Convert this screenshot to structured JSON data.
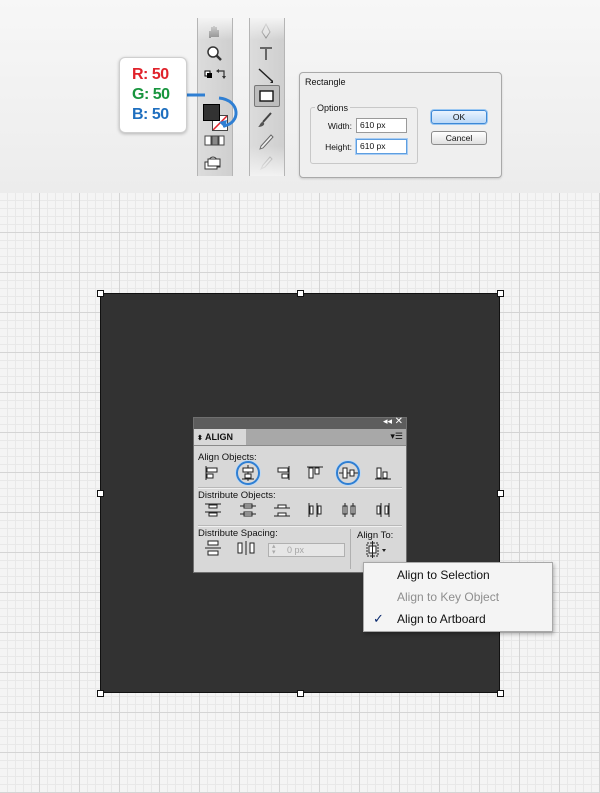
{
  "rgb_callout": {
    "r": "R: 50",
    "g": "G: 50",
    "b": "B: 50",
    "r_color": "#e0222b",
    "g_color": "#18953e",
    "b_color": "#1f6fbf"
  },
  "fill_color": "#323232",
  "tool_icons_left": [
    "hand-icon",
    "zoom-icon",
    "default-fill-stroke-icon",
    "swap-fill-stroke-icon",
    "fill-swatch",
    "stroke-swatch",
    "color-mode-icon",
    "draw-mode-icon",
    "screen-mode-icon"
  ],
  "tool_icons_right": [
    "pen-icon",
    "type-icon",
    "line-segment-icon",
    "rectangle-tool-icon",
    "paintbrush-icon",
    "pencil-icon",
    "blob-brush-icon"
  ],
  "rect_dialog": {
    "title": "Rectangle",
    "group_label": "Options",
    "width_label": "Width:",
    "width_value": "610 px",
    "height_label": "Height:",
    "height_value": "610 px",
    "ok_label": "OK",
    "cancel_label": "Cancel"
  },
  "align_panel": {
    "tab_label": "ALIGN",
    "align_objects_label": "Align Objects:",
    "distribute_objects_label": "Distribute Objects:",
    "distribute_spacing_label": "Distribute Spacing:",
    "align_to_label": "Align To:",
    "spacing_value": "0 px",
    "highlighted": [
      "horizontal-align-center",
      "vertical-align-center"
    ]
  },
  "align_to_menu": {
    "items": [
      {
        "label": "Align to Selection",
        "enabled": true,
        "checked": false
      },
      {
        "label": "Align to Key Object",
        "enabled": false,
        "checked": false
      },
      {
        "label": "Align to Artboard",
        "enabled": true,
        "checked": true
      }
    ],
    "check_mark": "✓"
  }
}
